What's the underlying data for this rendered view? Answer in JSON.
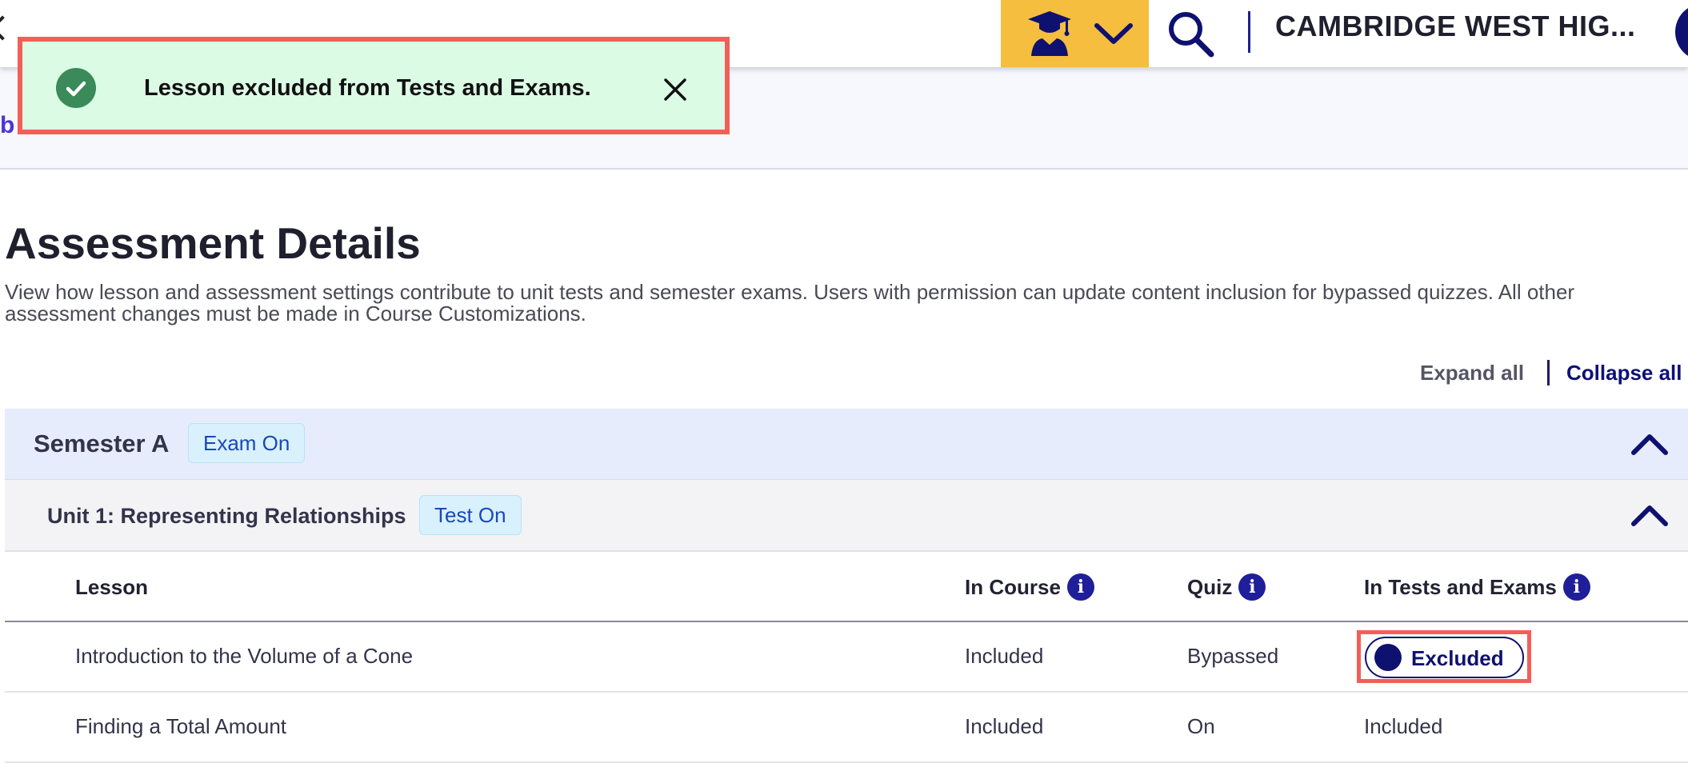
{
  "header": {
    "school_name": "CAMBRIDGE WEST HIG...",
    "icons": {
      "back": "chevron-left-icon",
      "role": "graduation-cap-icon",
      "dropdown": "chevron-down-icon",
      "search": "search-icon"
    },
    "colors": {
      "role_switcher_bg": "#f5be3f",
      "brand_navy": "#0e1170"
    }
  },
  "subheader": {
    "breadcrumb_fragment": "b"
  },
  "toast": {
    "message": "Lesson excluded from Tests and Exams.",
    "status": "success",
    "colors": {
      "background": "#dcfbe4",
      "check": "#3a8a5a",
      "highlight_border": "#f25f58"
    }
  },
  "page": {
    "title": "Assessment Details",
    "description": "View how lesson and assessment settings contribute to unit tests and semester exams. Users with permission can update content inclusion for bypassed quizzes. All other assessment changes must be made in Course Customizations.",
    "expand_all": "Expand all",
    "collapse_all": "Collapse all"
  },
  "semester": {
    "title": "Semester A",
    "badge": "Exam On"
  },
  "unit": {
    "title": "Unit 1: Representing Relationships",
    "badge": "Test On"
  },
  "table": {
    "headers": {
      "lesson": "Lesson",
      "in_course": "In Course",
      "quiz": "Quiz",
      "in_tests_and_exams": "In Tests and Exams"
    },
    "rows": [
      {
        "lesson": "Introduction to the Volume of a Cone",
        "in_course": "Included",
        "quiz": "Bypassed",
        "in_tests_and_exams": "Excluded",
        "in_tests_is_toggle": true
      },
      {
        "lesson": "Finding a Total Amount",
        "in_course": "Included",
        "quiz": "On",
        "in_tests_and_exams": "Included",
        "in_tests_is_toggle": false
      }
    ]
  }
}
